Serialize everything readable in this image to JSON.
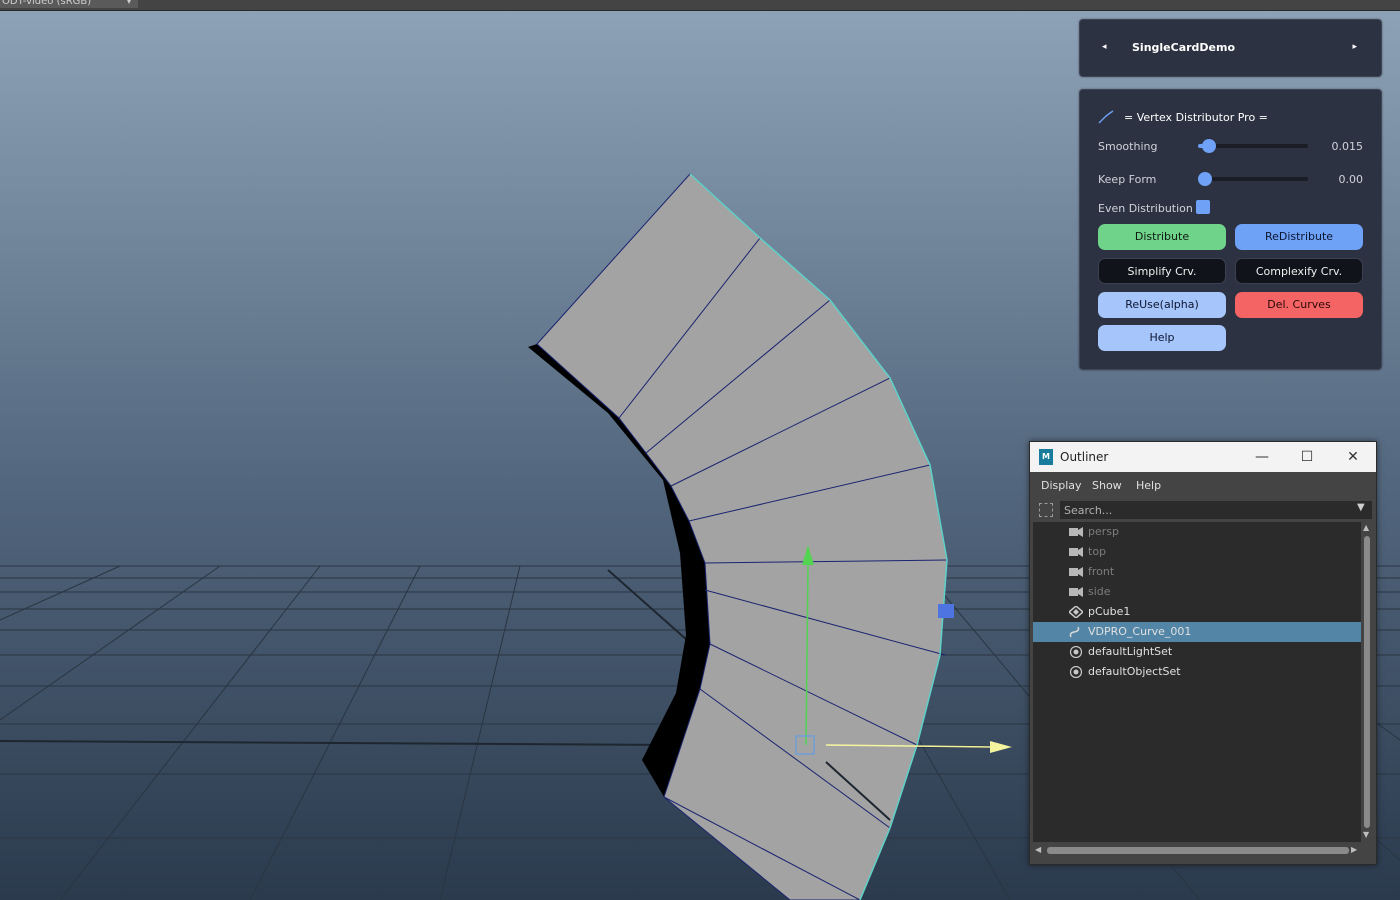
{
  "topbar": {
    "colorspace": "ODT-video (sRGB)",
    "colorspace_arrow": "▾"
  },
  "card": {
    "prev": "◂",
    "title": "SingleCardDemo",
    "next": "▸"
  },
  "vdp": {
    "title": "= Vertex Distributor Pro =",
    "smoothing": {
      "label": "Smoothing",
      "value": "0.015",
      "fraction": 0.1
    },
    "keep_form": {
      "label": "Keep Form",
      "value": "0.00",
      "fraction": 0.0
    },
    "even_distribution": {
      "label": "Even Distribution",
      "checked": true
    },
    "buttons": {
      "distribute": "Distribute",
      "redistribute": "ReDistribute",
      "simplify": "Simplify Crv.",
      "complexify": "Complexify Crv.",
      "reuse": "ReUse(alpha)",
      "del_curves": "Del. Curves",
      "help": "Help"
    },
    "accent": "#6fa1f7"
  },
  "outliner": {
    "logo": "M",
    "title": "Outliner",
    "window_buttons": {
      "minimize": "—",
      "maximize": "☐",
      "close": "✕"
    },
    "menu": [
      "Display",
      "Show",
      "Help"
    ],
    "search_placeholder": "Search...",
    "items": [
      {
        "label": "persp",
        "icon": "camera-icon",
        "dim": true
      },
      {
        "label": "top",
        "icon": "camera-icon",
        "dim": true
      },
      {
        "label": "front",
        "icon": "camera-icon",
        "dim": true
      },
      {
        "label": "side",
        "icon": "camera-icon",
        "dim": true
      },
      {
        "label": "pCube1",
        "icon": "mesh-icon",
        "dim": false
      },
      {
        "label": "VDPRO_Curve_001",
        "icon": "curve-icon",
        "dim": false,
        "selected": true
      },
      {
        "label": "defaultLightSet",
        "icon": "set-icon",
        "dim": false
      },
      {
        "label": "defaultObjectSet",
        "icon": "set-icon",
        "dim": false
      }
    ],
    "selection_color": "#5285a6"
  }
}
